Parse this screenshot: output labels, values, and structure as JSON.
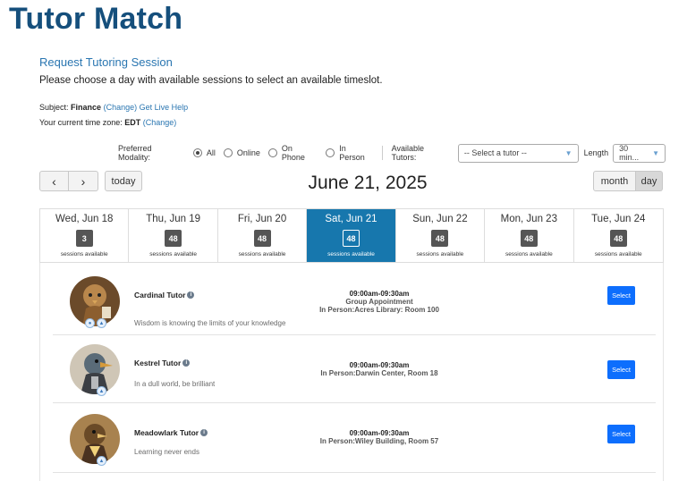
{
  "app": {
    "title": "Tutor Match"
  },
  "request": {
    "title": "Request Tutoring Session",
    "instructions": "Please choose a day with available sessions to select an available timeslot.",
    "subject_label": "Subject:",
    "subject_value": "Finance",
    "change_link": "(Change)",
    "live_help_link": "Get Live Help",
    "timezone_label": "Your current time zone:",
    "timezone_value": "EDT",
    "timezone_change_link": "(Change)"
  },
  "filters": {
    "modality_label": "Preferred Modality:",
    "modalities": [
      {
        "label": "All",
        "selected": true
      },
      {
        "label": "Online",
        "selected": false
      },
      {
        "label": "On Phone",
        "selected": false
      },
      {
        "label": "In Person",
        "selected": false
      }
    ],
    "tutors_label": "Available Tutors:",
    "tutor_select_value": "-- Select a tutor --",
    "length_label": "Length",
    "length_value": "30 min..."
  },
  "calendar": {
    "today_label": "today",
    "current_date": "June 21, 2025",
    "month_label": "month",
    "day_label": "day",
    "days": [
      {
        "name": "Wed, Jun 18",
        "count": "3",
        "caption": "sessions available",
        "active": false
      },
      {
        "name": "Thu, Jun 19",
        "count": "48",
        "caption": "sessions available",
        "active": false
      },
      {
        "name": "Fri, Jun 20",
        "count": "48",
        "caption": "sessions available",
        "active": false
      },
      {
        "name": "Sat, Jun 21",
        "count": "48",
        "caption": "sessions available",
        "active": true
      },
      {
        "name": "Sun, Jun 22",
        "count": "48",
        "caption": "sessions available",
        "active": false
      },
      {
        "name": "Mon, Jun 23",
        "count": "48",
        "caption": "sessions available",
        "active": false
      },
      {
        "name": "Tue, Jun 24",
        "count": "48",
        "caption": "sessions available",
        "active": false
      }
    ]
  },
  "sessions": [
    {
      "tutor": "Cardinal Tutor",
      "quote": "Wisdom is knowing the limits of your knowledge",
      "time": "09:00am-09:30am",
      "type": "Group Appointment",
      "location": "In Person:Acres Library: Room 100",
      "select_label": "Select"
    },
    {
      "tutor": "Kestrel Tutor",
      "quote": "In a dull world, be brilliant",
      "time": "09:00am-09:30am",
      "location": "In Person:Darwin Center, Room 18",
      "select_label": "Select"
    },
    {
      "tutor": "Meadowlark Tutor",
      "quote": "Learning never ends",
      "time": "09:00am-09:30am",
      "location": "In Person:Wiley Building, Room 57",
      "select_label": "Select"
    }
  ],
  "colors": {
    "brand": "#154f7c",
    "link": "#2a76b1",
    "active_day": "#1777ad",
    "select_button": "#0d6efd"
  }
}
